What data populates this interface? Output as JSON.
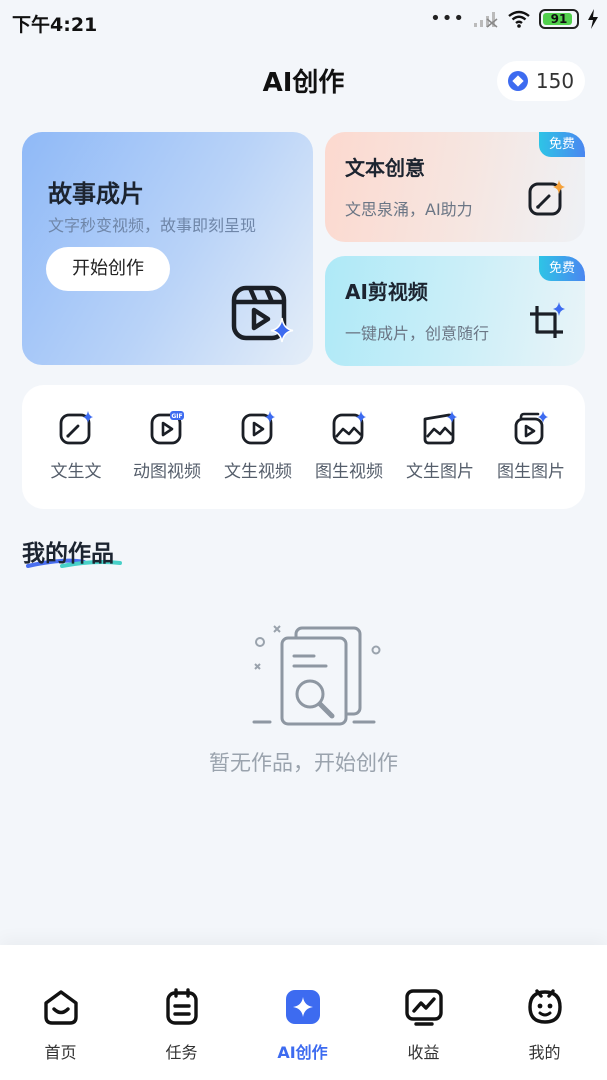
{
  "status_bar": {
    "time": "下午4:21",
    "dots": "•••",
    "battery": "91",
    "battery_level": 0.91
  },
  "header": {
    "title": "AI创作",
    "points": "150",
    "points_icon": "diamond-icon"
  },
  "feature_main": {
    "title": "故事成片",
    "subtitle": "文字秒变视频，故事即刻呈现",
    "button": "开始创作",
    "icon": "film-sparkle-icon"
  },
  "feature_cards": [
    {
      "title": "文本创意",
      "subtitle": "文思泉涌，AI助力",
      "badge": "免费",
      "icon": "pen-sparkle-icon",
      "gradient": "#fcd9cf"
    },
    {
      "title": "AI剪视频",
      "subtitle": "一键成片，创意随行",
      "badge": "免费",
      "icon": "crop-sparkle-icon",
      "gradient": "#aee9f7"
    }
  ],
  "tools": [
    {
      "label": "文生文",
      "icon": "text-to-text-icon"
    },
    {
      "label": "动图视频",
      "icon": "gif-video-icon"
    },
    {
      "label": "文生视频",
      "icon": "text-to-video-icon"
    },
    {
      "label": "图生视频",
      "icon": "image-to-video-icon"
    },
    {
      "label": "文生图片",
      "icon": "text-to-image-icon"
    },
    {
      "label": "图生图片",
      "icon": "image-to-image-icon"
    }
  ],
  "works": {
    "title": "我的作品",
    "empty_text": "暂无作品，开始创作"
  },
  "bottom_nav": [
    {
      "label": "首页",
      "icon": "home-icon",
      "active": false
    },
    {
      "label": "任务",
      "icon": "task-icon",
      "active": false
    },
    {
      "label": "AI创作",
      "icon": "ai-create-icon",
      "active": true
    },
    {
      "label": "收益",
      "icon": "earnings-icon",
      "active": false
    },
    {
      "label": "我的",
      "icon": "profile-icon",
      "active": false
    }
  ],
  "colors": {
    "accent": "#3d6bf0",
    "background": "#f3f6fa",
    "badge": "#4a86f0"
  }
}
